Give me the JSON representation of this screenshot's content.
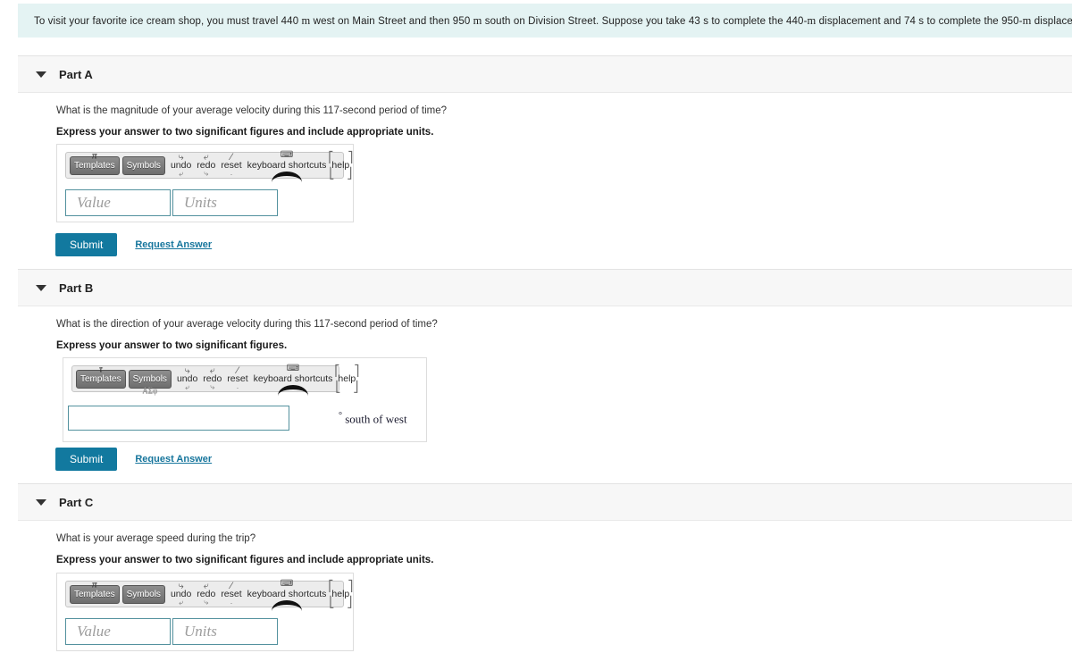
{
  "problem": {
    "text_pre": "To visit your favorite ice cream shop, you must travel 440 ",
    "unit1": "m",
    "text_mid1": " west on Main Street and then 950 ",
    "unit2": "m",
    "text_mid2": " south on Division Street. Suppose you take 43 s to complete the 440-",
    "unit3": "m",
    "text_mid3": " displacement and 74 s to complete the 950-",
    "unit4": "m",
    "text_end": " displacement."
  },
  "toolbar": {
    "templates_label": "Templates",
    "symbols_label": "Symbols",
    "undo_label": "undo",
    "redo_label": "redo",
    "reset_label": "reset",
    "keyboard_label": "keyboard",
    "shortcuts_label": "shortcuts",
    "help_label": "help",
    "templates_glyph_pi": "π",
    "templates_glyph_tau": "τ",
    "symbols_glyph_greek": "ΑΣφ",
    "undo_arc_top": "⤷",
    "undo_arc_bot": "⤶",
    "redo_arc_top": "⤶",
    "redo_arc_bot": "⤷",
    "reset_arc_top": "⁄",
    "reset_arc_bot": "·",
    "keyboard_icon": "⌨",
    "help_bracket_tl": "⎡",
    "help_bracket_tr": "⎤",
    "help_bracket_bl": "⎣",
    "help_bracket_br": "⎦"
  },
  "buttons": {
    "submit_label": "Submit",
    "request_answer_label": "Request Answer"
  },
  "fields": {
    "value_placeholder": "Value",
    "units_placeholder": "Units",
    "direction_value": ""
  },
  "colors": {
    "banner_bg": "#e4f3f3",
    "part_header_bg": "#f7f7f7",
    "submit_bg": "#12799f",
    "link": "#16759c",
    "field_border": "#53919e"
  },
  "parts": [
    {
      "title": "Part A",
      "question": "What is the magnitude of your average velocity during this 117-second period of time?",
      "instruction": "Express your answer to two significant figures and include appropriate units.",
      "answer_type": "value-units"
    },
    {
      "title": "Part B",
      "question": "What is the direction of your average velocity during this 117-second period of time?",
      "instruction": "Express your answer to two significant figures.",
      "answer_type": "single-field",
      "suffix": "south of west",
      "suffix_degree": "°"
    },
    {
      "title": "Part C",
      "question": "What is your average speed during the trip?",
      "instruction": "Express your answer to two significant figures and include appropriate units.",
      "answer_type": "value-units"
    }
  ]
}
